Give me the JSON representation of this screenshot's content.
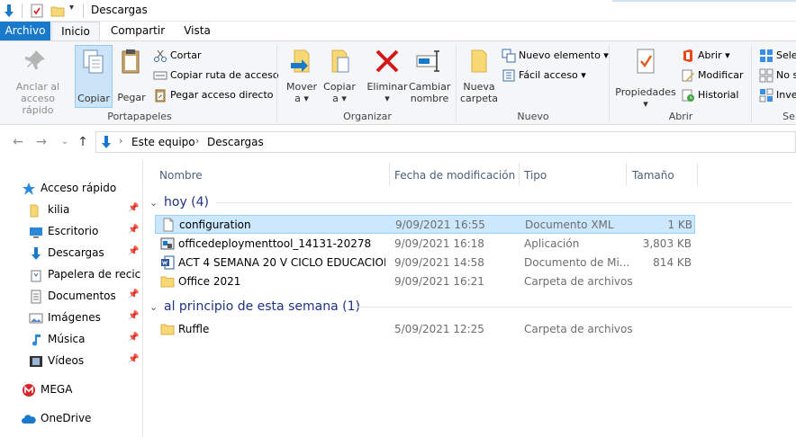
{
  "window": {
    "title": "Descargas"
  },
  "tabs": {
    "file": "Archivo",
    "home": "Inicio",
    "share": "Compartir",
    "view": "Vista"
  },
  "ribbon": {
    "pin_quick": "Anclar al\nacceso rápido",
    "pin_quick_l1": "Anclar al",
    "pin_quick_l2": "acceso rápido",
    "copy": "Copiar",
    "paste": "Pegar",
    "cut": "Cortar",
    "copy_path": "Copiar ruta de acceso",
    "paste_shortcut": "Pegar acceso directo",
    "group_clipboard": "Portapapeles",
    "move_to_l1": "Mover",
    "move_to_l2": "a ▾",
    "copy_to_l1": "Copiar",
    "copy_to_l2": "a ▾",
    "delete_l1": "Eliminar",
    "delete_l2": "▾",
    "rename_l1": "Cambiar",
    "rename_l2": "nombre",
    "group_organize": "Organizar",
    "new_folder_l1": "Nueva",
    "new_folder_l2": "carpeta",
    "new_item": "Nuevo elemento ▾",
    "easy_access": "Fácil acceso ▾",
    "group_new": "Nuevo",
    "properties_l1": "Propiedades",
    "properties_l2": "▾",
    "open": "Abrir ▾",
    "modify": "Modificar",
    "history": "Historial",
    "group_open": "Abrir",
    "select_all": "Selec",
    "select_none": "No s",
    "invert": "Inver",
    "group_select": "Se"
  },
  "address": {
    "crumbs": [
      "Este equipo",
      "Descargas"
    ]
  },
  "nav": {
    "quick_access": "Acceso rápido",
    "items": [
      "kilia",
      "Escritorio",
      "Descargas",
      "Papelera de recic",
      "Documentos",
      "Imágenes",
      "Música",
      "Vídeos"
    ],
    "mega": "MEGA",
    "onedrive": "OneDrive"
  },
  "columns": {
    "name": "Nombre",
    "date": "Fecha de modificación",
    "type": "Tipo",
    "size": "Tamaño"
  },
  "groups": [
    {
      "title": "hoy (4)",
      "rows": [
        {
          "name": "configuration",
          "date": "9/09/2021 16:55",
          "type": "Documento XML",
          "size": "1 KB"
        },
        {
          "name": "officedeploymenttool_14131-20278",
          "date": "9/09/2021 16:18",
          "type": "Aplicación",
          "size": "3,803 KB"
        },
        {
          "name": "ACT 4 SEMANA 20 V CICLO EDUCACION ...",
          "date": "9/09/2021 14:58",
          "type": "Documento de Mi...",
          "size": "814 KB"
        },
        {
          "name": "Office 2021",
          "date": "9/09/2021 16:21",
          "type": "Carpeta de archivos",
          "size": ""
        }
      ]
    },
    {
      "title": "al principio de esta semana (1)",
      "rows": [
        {
          "name": "Ruffle",
          "date": "5/09/2021 12:25",
          "type": "Carpeta de archivos",
          "size": ""
        }
      ]
    }
  ],
  "colors": {
    "accent": "#1979ca",
    "selection": "#cce8ff",
    "group_header": "#1e3287",
    "folder": "#f8d775"
  }
}
